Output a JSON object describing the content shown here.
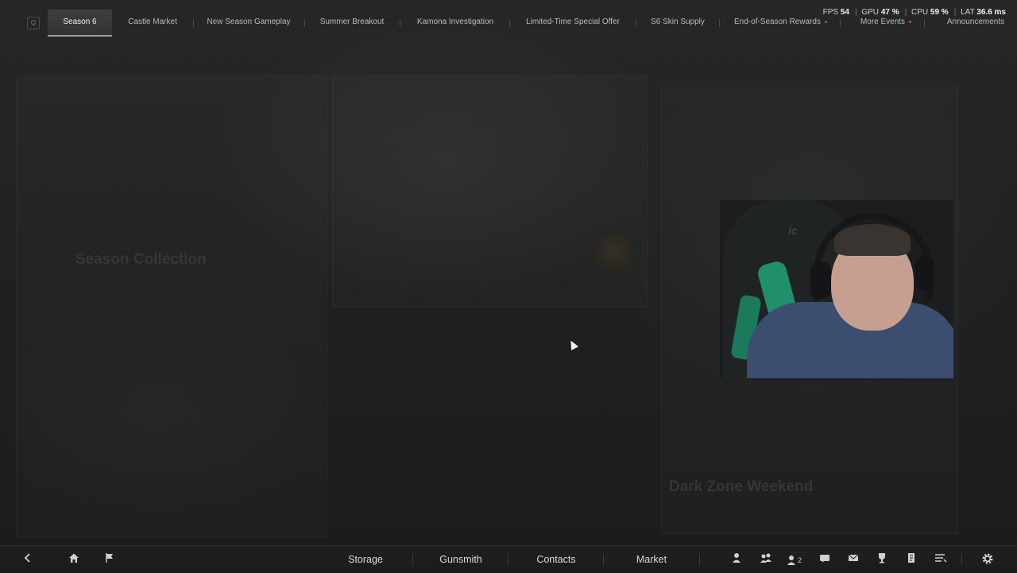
{
  "top_nav": {
    "key_hint": "Q",
    "tabs": [
      {
        "label": "Season 6",
        "active": true,
        "badge": false
      },
      {
        "label": "Castle Market",
        "active": false,
        "badge": false
      },
      {
        "label": "New Season Gameplay",
        "active": false,
        "badge": false
      },
      {
        "label": "Summer Breakout",
        "active": false,
        "badge": false
      },
      {
        "label": "Kamona Investigation",
        "active": false,
        "badge": false
      },
      {
        "label": "Limited-Time Special Offer",
        "active": false,
        "badge": false
      },
      {
        "label": "S6 Skin Supply",
        "active": false,
        "badge": false
      },
      {
        "label": "End-of-Season Rewards",
        "active": false,
        "badge": true
      },
      {
        "label": "More Events",
        "active": false,
        "badge": true
      },
      {
        "label": "Announcements",
        "active": false,
        "badge": false
      }
    ]
  },
  "stats": {
    "fps_label": "FPS",
    "fps": "54",
    "gpu_label": "GPU",
    "gpu": "47 %",
    "cpu_label": "CPU",
    "cpu": "59 %",
    "lat_label": "LAT",
    "lat": "36.6 ms"
  },
  "background_panels": {
    "left_title": "Season Collection",
    "right_title": "Dark Zone Weekend"
  },
  "bottom_bar": {
    "nav": [
      "Storage",
      "Gunsmith",
      "Contacts",
      "Market"
    ],
    "friends_count": "2",
    "icons_left": [
      "back-arrow-icon",
      "home-icon",
      "flag-icon"
    ],
    "icons_right": [
      "profile-icon",
      "squad-icon",
      "friends-icon",
      "chat-icon",
      "mail-icon",
      "trophy-icon",
      "tasks-icon",
      "menu-icon",
      "settings-icon"
    ]
  },
  "colors": {
    "accent": "#9d9f9e",
    "badge": "#d6443c",
    "webcam_green": "#1f8f6c"
  }
}
